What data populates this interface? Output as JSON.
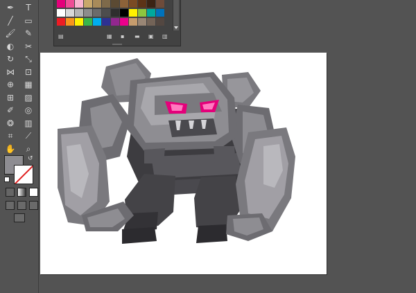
{
  "toolbar": {
    "tools": [
      [
        "pen-tool-icon",
        "type-tool-icon"
      ],
      [
        "line-tool-icon",
        "rectangle-tool-icon"
      ],
      [
        "paintbrush-tool-icon",
        "pencil-tool-icon"
      ],
      [
        "blob-brush-tool-icon",
        "eraser-tool-icon"
      ],
      [
        "rotate-tool-icon",
        "scale-tool-icon"
      ],
      [
        "width-tool-icon",
        "free-transform-tool-icon"
      ],
      [
        "shape-builder-tool-icon",
        "perspective-grid-tool-icon"
      ],
      [
        "mesh-tool-icon",
        "gradient-tool-icon"
      ],
      [
        "eyedropper-tool-icon",
        "blend-tool-icon"
      ],
      [
        "symbol-sprayer-tool-icon",
        "column-graph-tool-icon"
      ],
      [
        "artboard-tool-icon",
        "slice-tool-icon"
      ],
      [
        "hand-tool-icon",
        "zoom-tool-icon"
      ]
    ],
    "fill_color": "#8e8d92",
    "stroke_color": "none"
  },
  "swatches": {
    "rows": [
      [
        "#e4007a",
        "#ef4d96",
        "#f9b4d0",
        "#c8a86b",
        "#a88b5a",
        "#7e6a4a",
        "#5b4a33",
        "#8c6239",
        "#7a4a24",
        "#5c3317",
        "#3b2314",
        "#6e4b3a"
      ],
      [
        "#ffffff",
        "#d8d8d8",
        "#b5b5b5",
        "#8c8c8c",
        "#6b6b6b",
        "#4d4d4d",
        "#2e2e2e",
        "#000000",
        "#fff200",
        "#8dc63f",
        "#00a99d",
        "#0072bc"
      ],
      [
        "#ed1c24",
        "#f7941d",
        "#fff200",
        "#39b54a",
        "#00aeef",
        "#2e3192",
        "#92278f",
        "#ec008c",
        "#c69c6d",
        "#998675",
        "#736357",
        "#534741"
      ]
    ]
  },
  "canvas": {
    "background": "#ffffff",
    "artwork": "golem-illustration"
  }
}
